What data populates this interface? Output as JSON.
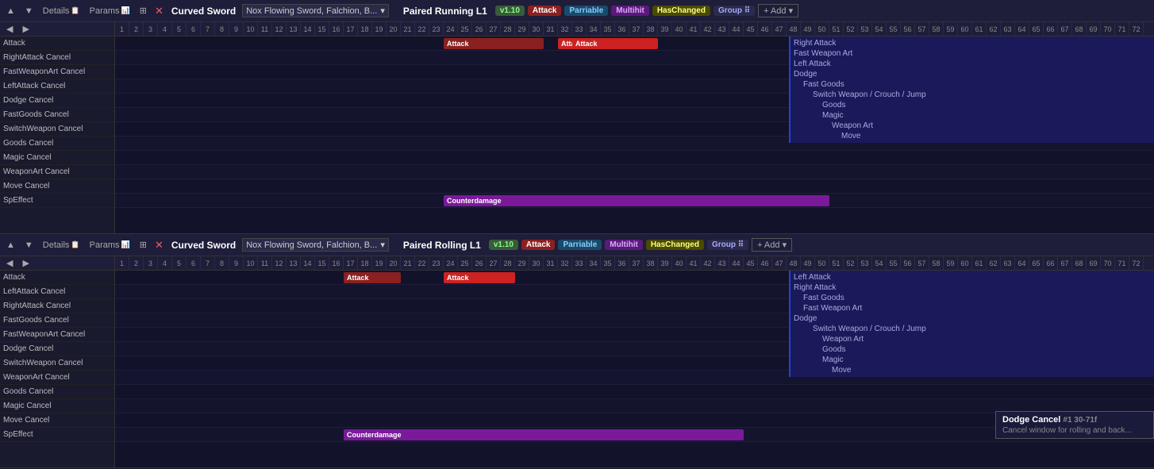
{
  "panels": [
    {
      "id": "panel-top",
      "nav": {
        "up": "▲",
        "down": "▼",
        "left": "◀",
        "right": "▶"
      },
      "close": "✕",
      "weapon": "Curved Sword",
      "animation": "Nox Flowing Sword, Falchion, B...",
      "animation_dropdown": true,
      "action": "Paired Running L1",
      "version": "v1.10",
      "badges": [
        "Attack",
        "Parriable",
        "Multihit",
        "HasChanged"
      ],
      "group": "Group",
      "add": "+ Add",
      "row_labels": [
        "Attack",
        "RightAttack Cancel",
        "FastWeaponArt Cancel",
        "LeftAttack Cancel",
        "Dodge Cancel",
        "FastGoods Cancel",
        "SwitchWeapon Cancel",
        "Goods Cancel",
        "Magic Cancel",
        "WeaponArt Cancel",
        "Move Cancel",
        "SpEffect"
      ],
      "frames": [
        1,
        2,
        3,
        4,
        5,
        6,
        7,
        8,
        9,
        10,
        11,
        12,
        13,
        14,
        15,
        16,
        17,
        18,
        19,
        20,
        21,
        22,
        23,
        24,
        25,
        26,
        27,
        28,
        29,
        30,
        31,
        32,
        33,
        34,
        35,
        36,
        37,
        38,
        39,
        40,
        41,
        42,
        43,
        44,
        45,
        46,
        47,
        48,
        49,
        50,
        51,
        52,
        53,
        54,
        55,
        56,
        57,
        58,
        59,
        60,
        61,
        62
      ],
      "events": [
        {
          "row": 0,
          "label": "Attack",
          "startFrame": 24,
          "endFrame": 30,
          "type": "attack"
        },
        {
          "row": 0,
          "label": "Attack",
          "startFrame": 32,
          "endFrame": 36,
          "type": "attack2"
        },
        {
          "row": 0,
          "label": "Attack",
          "startFrame": 33,
          "endFrame": 38,
          "type": "attack2"
        },
        {
          "row": 11,
          "label": "Counterdamage",
          "startFrame": 24,
          "endFrame": 50,
          "type": "counterdamage"
        }
      ],
      "cancel_tree": [
        {
          "indent": 0,
          "text": "Right Attack"
        },
        {
          "indent": 0,
          "text": "Fast Weapon Art"
        },
        {
          "indent": 0,
          "text": "Left Attack"
        },
        {
          "indent": 0,
          "text": "Dodge"
        },
        {
          "indent": 2,
          "text": "Fast Goods"
        },
        {
          "indent": 4,
          "text": "Switch Weapon / Crouch / Jump"
        },
        {
          "indent": 6,
          "text": "Goods"
        },
        {
          "indent": 6,
          "text": "Magic"
        },
        {
          "indent": 8,
          "text": "Weapon Art"
        },
        {
          "indent": 10,
          "text": "Move"
        }
      ]
    },
    {
      "id": "panel-bottom",
      "nav": {
        "up": "▲",
        "down": "▼",
        "left": "◀",
        "right": "▶"
      },
      "close": "✕",
      "weapon": "Curved Sword",
      "animation": "Nox Flowing Sword, Falchion, B...",
      "animation_dropdown": true,
      "action": "Paired Rolling L1",
      "version": "v1.10",
      "badges": [
        "Attack",
        "Parriable",
        "Multihit",
        "HasChanged"
      ],
      "group": "Group",
      "add": "+ Add",
      "row_labels": [
        "Attack",
        "LeftAttack Cancel",
        "RightAttack Cancel",
        "FastGoods Cancel",
        "FastWeaponArt Cancel",
        "Dodge Cancel",
        "SwitchWeapon Cancel",
        "WeaponArt Cancel",
        "Goods Cancel",
        "Magic Cancel",
        "Move Cancel",
        "SpEffect"
      ],
      "frames": [
        1,
        2,
        3,
        4,
        5,
        6,
        7,
        8,
        9,
        10,
        11,
        12,
        13,
        14,
        15,
        16,
        17,
        18,
        19,
        20,
        21,
        22,
        23,
        24,
        25,
        26,
        27,
        28,
        29,
        30,
        31,
        32,
        33,
        34,
        35,
        36,
        37,
        38,
        39,
        40,
        41,
        42,
        43,
        44,
        45,
        46,
        47,
        48,
        49,
        50,
        51,
        52,
        53,
        54,
        55,
        56,
        57,
        58,
        59,
        60,
        61,
        62
      ],
      "events": [
        {
          "row": 0,
          "label": "Attack",
          "startFrame": 17,
          "endFrame": 20,
          "type": "attack"
        },
        {
          "row": 0,
          "label": "Attack",
          "startFrame": 24,
          "endFrame": 28,
          "type": "attack2"
        },
        {
          "row": 11,
          "label": "Counterdamage",
          "startFrame": 17,
          "endFrame": 44,
          "type": "counterdamage"
        }
      ],
      "cancel_tree": [
        {
          "indent": 0,
          "text": "Left Attack"
        },
        {
          "indent": 0,
          "text": "Right Attack"
        },
        {
          "indent": 2,
          "text": "Fast Goods"
        },
        {
          "indent": 2,
          "text": "Fast Weapon Art"
        },
        {
          "indent": 0,
          "text": "Dodge"
        },
        {
          "indent": 4,
          "text": "Switch Weapon / Crouch / Jump"
        },
        {
          "indent": 6,
          "text": "Weapon Art"
        },
        {
          "indent": 6,
          "text": "Goods"
        },
        {
          "indent": 6,
          "text": "Magic"
        },
        {
          "indent": 8,
          "text": "Move"
        }
      ],
      "tooltip": {
        "title": "Dodge Cancel",
        "hash": "#1",
        "range": "30-71f",
        "desc": "Cancel window for rolling and back..."
      }
    }
  ]
}
